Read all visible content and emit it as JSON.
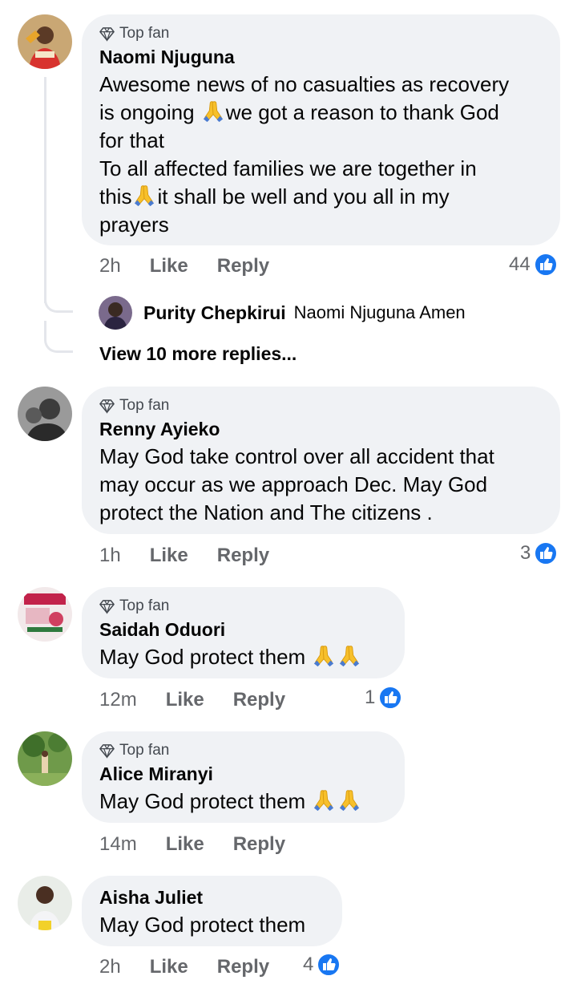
{
  "badge_label": "Top fan",
  "action_like": "Like",
  "action_reply": "Reply",
  "comments": [
    {
      "author": "Naomi Njuguna",
      "top_fan": true,
      "text_parts": [
        "Awesome news of no casualties as recovery",
        "is ongoing ",
        "we got a reason to thank God",
        "for that",
        "To all affected families we are together in",
        "this",
        "it shall be well and you all in my",
        "prayers"
      ],
      "time": "2h",
      "reactions": "44",
      "replies": {
        "preview_author": "Purity Chepkirui",
        "preview_text": "Naomi Njuguna Amen",
        "view_more": "View 10 more replies..."
      }
    },
    {
      "author": "Renny Ayieko",
      "top_fan": true,
      "text": "May God take control over all accident that\nmay occur as we approach Dec. May God\nprotect the Nation and The citizens .",
      "time": "1h",
      "reactions": "3"
    },
    {
      "author": "Saidah Oduori",
      "top_fan": true,
      "text": "May God protect them ",
      "time": "12m",
      "reactions": "1"
    },
    {
      "author": "Alice Miranyi",
      "top_fan": true,
      "text": "May God protect them ",
      "time": "14m",
      "reactions": ""
    },
    {
      "author": "Aisha Juliet",
      "top_fan": false,
      "text": "May God protect them",
      "time": "2h",
      "reactions": "4"
    }
  ],
  "colors": {
    "bubble": "#f0f2f5",
    "muted": "#65676b",
    "like_blue": "#1877f2",
    "pray_emoji": "#f7c02b"
  },
  "icons": {
    "top_fan": "diamond-icon",
    "reaction": "like-thumb-icon",
    "emoji": "folded-hands-emoji"
  }
}
